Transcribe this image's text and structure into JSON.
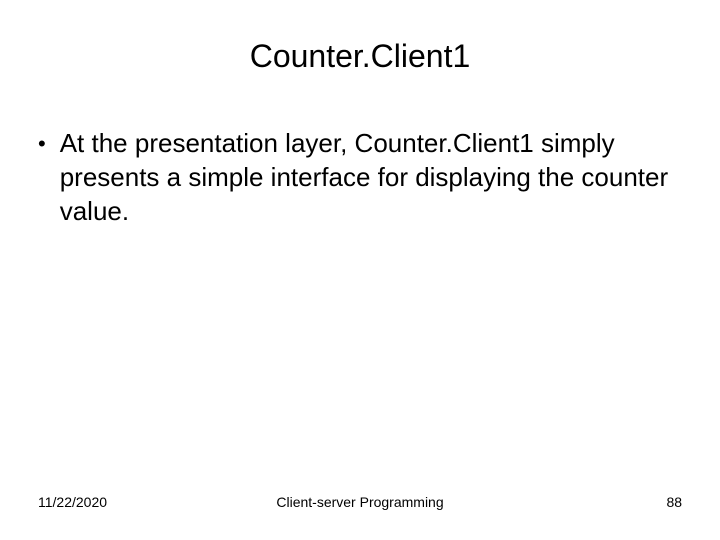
{
  "slide": {
    "title": "Counter.Client1",
    "bullets": [
      "At the presentation layer, Counter.Client1 simply presents a simple interface for displaying the counter value."
    ]
  },
  "footer": {
    "date": "11/22/2020",
    "title": "Client-server Programming",
    "page": "88"
  }
}
